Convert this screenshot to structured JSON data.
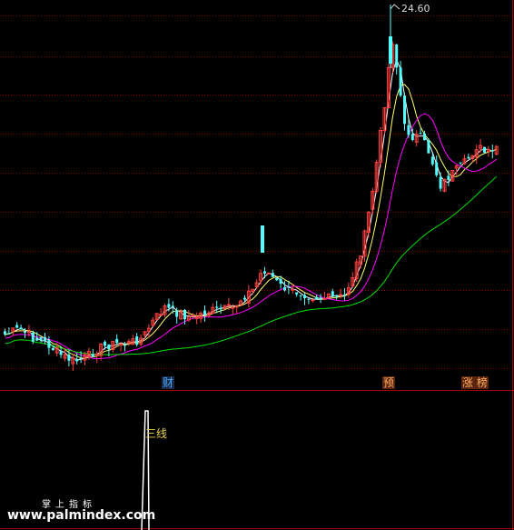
{
  "chart_data": {
    "type": "candlestick",
    "price_peak_label": "24.60",
    "candle_colors": {
      "up": "#ff4040",
      "down": "#54ffff"
    },
    "ma_colors": {
      "ma_short": "#ffffff",
      "ma_mid": "#ffff66",
      "ma_long": "#ff00ff",
      "ma_xlong": "#00e000"
    },
    "grid_color": "#880000",
    "approx_price_range": [
      6,
      25
    ]
  },
  "markers": {
    "cai": "财",
    "yu": "预",
    "zhang": "涨",
    "bang": "榜"
  },
  "indicator": {
    "line_label": "三线",
    "line_color": "#ffffff"
  },
  "watermark": {
    "title": "掌上指标",
    "url": "www.palmindex.com"
  }
}
